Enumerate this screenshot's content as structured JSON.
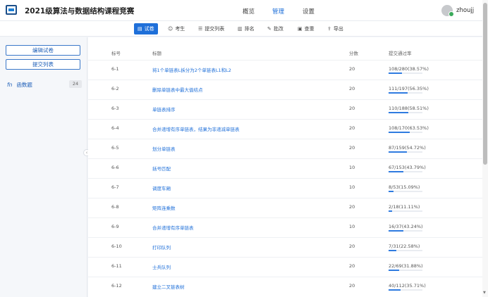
{
  "header": {
    "title": "2021级算法与数据结构课程竞赛",
    "nav": [
      {
        "label": "概览",
        "active": false
      },
      {
        "label": "管理",
        "active": true
      },
      {
        "label": "设置",
        "active": false
      }
    ],
    "username": "zhoujj"
  },
  "toolbar": {
    "tabs": [
      {
        "label": "试卷",
        "icon": "document-icon",
        "active": true
      },
      {
        "label": "考生",
        "icon": "users-icon",
        "active": false
      },
      {
        "label": "提交列表",
        "icon": "list-icon",
        "active": false
      },
      {
        "label": "排名",
        "icon": "bar-chart-icon",
        "active": false
      },
      {
        "label": "批改",
        "icon": "brush-icon",
        "active": false
      },
      {
        "label": "查重",
        "icon": "duplicate-check-icon",
        "active": false
      },
      {
        "label": "导出",
        "icon": "export-icon",
        "active": false
      }
    ]
  },
  "sidebar": {
    "edit_button": "编辑试卷",
    "submissions_button": "提交列表",
    "category": {
      "icon": "fn",
      "label": "函数题",
      "count": "24"
    }
  },
  "table": {
    "headers": {
      "id": "标号",
      "title": "标题",
      "score": "分数",
      "rate": "提交通过率"
    },
    "rows": [
      {
        "id": "6-1",
        "title": "将1个单链表L拆分为2个单链表L1和L2",
        "score": "20",
        "rate": "108/280(38.57%)",
        "pct": 38.57
      },
      {
        "id": "6-2",
        "title": "删除单链表中最大值结点",
        "score": "20",
        "rate": "111/197(56.35%)",
        "pct": 56.35
      },
      {
        "id": "6-3",
        "title": "单链表排序",
        "score": "20",
        "rate": "110/188(58.51%)",
        "pct": 58.51
      },
      {
        "id": "6-4",
        "title": "合并递增有序单链表，结果为非递减单链表",
        "score": "20",
        "rate": "108/170(63.53%)",
        "pct": 63.53
      },
      {
        "id": "6-5",
        "title": "划分单链表",
        "score": "20",
        "rate": "87/159(54.72%)",
        "pct": 54.72
      },
      {
        "id": "6-6",
        "title": "括号匹配",
        "score": "10",
        "rate": "67/153(43.79%)",
        "pct": 43.79
      },
      {
        "id": "6-7",
        "title": "调度车厢",
        "score": "10",
        "rate": "8/53(15.09%)",
        "pct": 15.09
      },
      {
        "id": "6-8",
        "title": "矩阵连乘数",
        "score": "20",
        "rate": "2/18(11.11%)",
        "pct": 11.11
      },
      {
        "id": "6-9",
        "title": "合并递增有序单链表",
        "score": "10",
        "rate": "16/37(43.24%)",
        "pct": 43.24
      },
      {
        "id": "6-10",
        "title": "打印队列",
        "score": "20",
        "rate": "7/31(22.58%)",
        "pct": 22.58
      },
      {
        "id": "6-11",
        "title": "士兵队列",
        "score": "20",
        "rate": "22/69(31.88%)",
        "pct": 31.88
      },
      {
        "id": "6-12",
        "title": "建立二叉链表树",
        "score": "20",
        "rate": "40/112(35.71%)",
        "pct": 35.71
      }
    ]
  },
  "colors": {
    "accent": "#1e6fd9",
    "progress": "#2f7be0",
    "avatar_badge": "#3aaa5a"
  }
}
